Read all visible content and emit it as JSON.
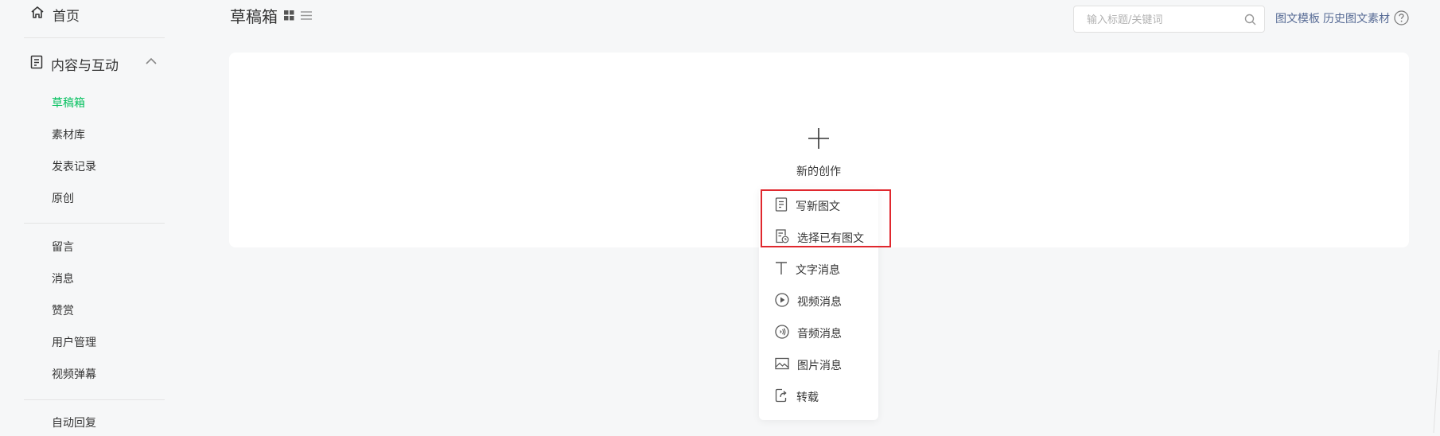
{
  "sidebar": {
    "home_label": "首页",
    "group_label": "内容与互动",
    "items_a": [
      {
        "label": "草稿箱",
        "active": true
      },
      {
        "label": "素材库"
      },
      {
        "label": "发表记录"
      },
      {
        "label": "原创"
      }
    ],
    "items_b": [
      {
        "label": "留言"
      },
      {
        "label": "消息"
      },
      {
        "label": "赞赏"
      },
      {
        "label": "用户管理"
      },
      {
        "label": "视频弹幕"
      }
    ],
    "items_c": [
      {
        "label": "自动回复"
      }
    ]
  },
  "header": {
    "title": "草稿箱",
    "search_placeholder": "输入标题/关键词",
    "link_template": "图文模板",
    "link_history": "历史图文素材"
  },
  "create": {
    "label": "新的创作"
  },
  "menu": {
    "items": [
      {
        "label": "写新图文",
        "icon": "document-icon"
      },
      {
        "label": "选择已有图文",
        "icon": "document-clock-icon"
      },
      {
        "label": "文字消息",
        "icon": "text-icon"
      },
      {
        "label": "视频消息",
        "icon": "play-circle-icon"
      },
      {
        "label": "音频消息",
        "icon": "audio-icon"
      },
      {
        "label": "图片消息",
        "icon": "image-icon"
      },
      {
        "label": "转载",
        "icon": "share-icon"
      }
    ]
  },
  "colors": {
    "accent": "#07c160",
    "link": "#576b95",
    "highlight": "#e0282e"
  }
}
